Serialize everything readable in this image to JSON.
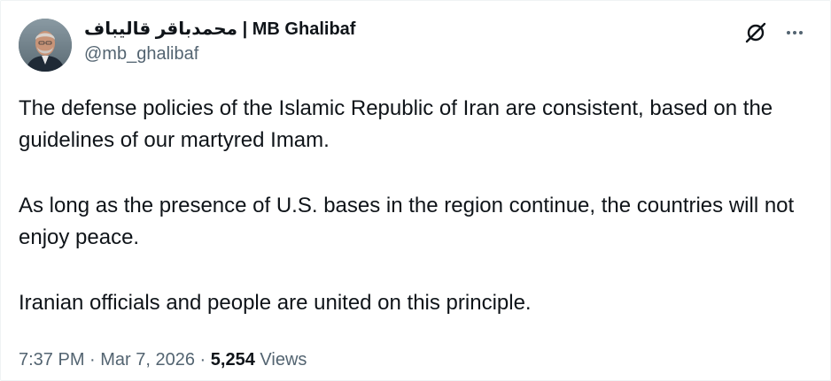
{
  "author": {
    "display_name": "محمدباقر قالیباف | MB Ghalibaf",
    "handle": "@mb_ghalibaf",
    "avatar_icon": "profile-photo"
  },
  "actions": {
    "grok_icon": "slashed-circle-icon",
    "more_icon": "more-horizontal-icon"
  },
  "tweet": {
    "paragraphs": [
      "The defense policies of the Islamic Republic of Iran are consistent, based on the guidelines of our martyred Imam.",
      "As long as the presence of U.S. bases in the region continue, the countries will not enjoy peace.",
      "Iranian officials and people are united on this principle."
    ]
  },
  "meta": {
    "time": "7:37 PM",
    "separator": " · ",
    "date": "Mar 7, 2026",
    "views_count": "5,254",
    "views_label": "Views"
  },
  "colors": {
    "text_primary": "#0f1419",
    "text_secondary": "#536471",
    "border": "#eff3f4"
  }
}
